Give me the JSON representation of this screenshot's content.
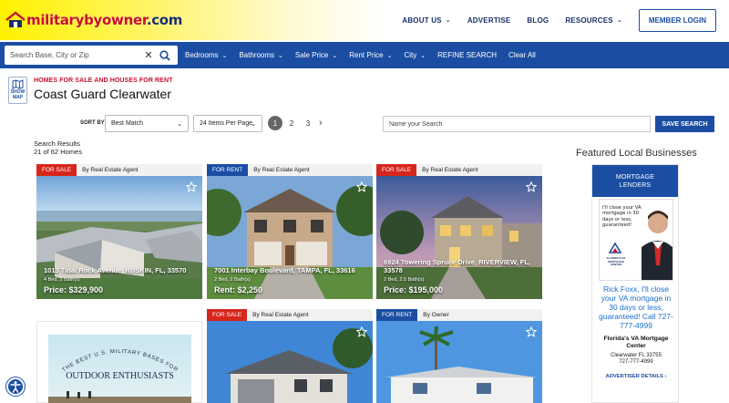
{
  "header": {
    "logo": {
      "brand": "militarybyowner",
      "tld": ".com"
    },
    "nav": [
      {
        "label": "ABOUT US",
        "has_dropdown": true
      },
      {
        "label": "ADVERTISE",
        "has_dropdown": false
      },
      {
        "label": "BLOG",
        "has_dropdown": false
      },
      {
        "label": "RESOURCES",
        "has_dropdown": true
      }
    ],
    "member_login": "MEMBER LOGIN"
  },
  "filterbar": {
    "search_placeholder": "Search Base, City or Zip",
    "filters": [
      "Bedrooms",
      "Bathrooms",
      "Sale Price",
      "Rent Price",
      "City",
      "REFINE SEARCH",
      "Clear All"
    ]
  },
  "page": {
    "show_map": "SHOW MAP",
    "breadcrumb": "HOMES FOR SALE AND HOUSES FOR RENT",
    "title": "Coast Guard Clearwater"
  },
  "controls": {
    "sort_label": "SORT BY",
    "sort_value": "Best Match",
    "per_page_value": "24 Items Per Page",
    "pages": [
      "1",
      "2",
      "3"
    ],
    "name_search_placeholder": "Name your Search",
    "save_search": "SAVE SEARCH"
  },
  "results": {
    "label": "Search Results",
    "count": "21 of 62 Homes"
  },
  "listings": [
    {
      "status": "FOR SALE",
      "type": "sale",
      "lister": "By Real Estate Agent",
      "address": "1013 Tidal Rock Avenue, RUSKIN, FL, 33570",
      "beds": "4 Bed, 2 Bath(s)",
      "price": "Price: $329,900"
    },
    {
      "status": "FOR RENT",
      "type": "rent",
      "lister": "By Real Estate Agent",
      "address": "7001 Interbay Boulevard, TAMPA, FL, 33616",
      "beds": "2 Bed, 2 Bath(s)",
      "price": "Rent: $2,250"
    },
    {
      "status": "FOR SALE",
      "type": "sale",
      "lister": "By Real Estate Agent",
      "address": "6924 Towering Spruce Drive, RIVERVIEW, FL, 33578",
      "beds": "2 Bed, 2.5 Bath(s)",
      "price": "Price: $195,000"
    },
    {
      "status": "FOR SALE",
      "type": "sale",
      "lister": "By Real Estate Agent"
    },
    {
      "status": "FOR RENT",
      "type": "rent",
      "lister": "By Owner"
    }
  ],
  "promo": {
    "arc": "THE BEST U.S. MILITARY BASES FOR",
    "headline": "OUTDOOR ENTHUSIASTS"
  },
  "sidebar": {
    "title": "Featured Local Businesses",
    "category": "MORTGAGE LENDERS",
    "ad_text": "I'll close your VA mortgage in 30 days or less, guaranteed!",
    "ad_logo": "FLORIDA'S VA MORTGAGE CENTER",
    "description": "Rick Foxx, I'll close your VA mortgage in 30 days or less, guaranteed! Call 727-777-4999",
    "business_name": "Florida's VA Mortgage Center",
    "address_line": "Clearwater FL 33755",
    "phone": "727-777-4999",
    "details_link": "ADVERTISER DETAILS ›"
  },
  "colors": {
    "brand_blue": "#1b4ea3",
    "sale_red": "#d6261c",
    "logo_red": "#c8102e",
    "link_blue": "#1b6fd1"
  }
}
